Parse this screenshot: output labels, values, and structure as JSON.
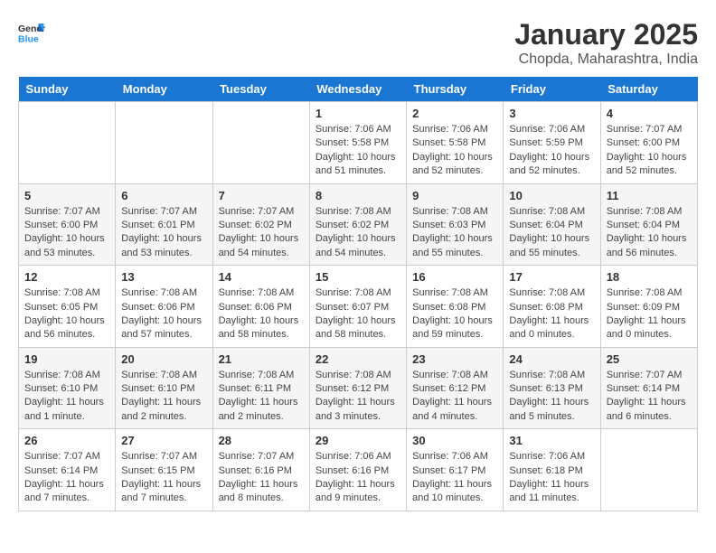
{
  "header": {
    "logo_general": "General",
    "logo_blue": "Blue",
    "month": "January 2025",
    "location": "Chopda, Maharashtra, India"
  },
  "days_of_week": [
    "Sunday",
    "Monday",
    "Tuesday",
    "Wednesday",
    "Thursday",
    "Friday",
    "Saturday"
  ],
  "weeks": [
    [
      {
        "day": "",
        "info": ""
      },
      {
        "day": "",
        "info": ""
      },
      {
        "day": "",
        "info": ""
      },
      {
        "day": "1",
        "info": "Sunrise: 7:06 AM\nSunset: 5:58 PM\nDaylight: 10 hours\nand 51 minutes."
      },
      {
        "day": "2",
        "info": "Sunrise: 7:06 AM\nSunset: 5:58 PM\nDaylight: 10 hours\nand 52 minutes."
      },
      {
        "day": "3",
        "info": "Sunrise: 7:06 AM\nSunset: 5:59 PM\nDaylight: 10 hours\nand 52 minutes."
      },
      {
        "day": "4",
        "info": "Sunrise: 7:07 AM\nSunset: 6:00 PM\nDaylight: 10 hours\nand 52 minutes."
      }
    ],
    [
      {
        "day": "5",
        "info": "Sunrise: 7:07 AM\nSunset: 6:00 PM\nDaylight: 10 hours\nand 53 minutes."
      },
      {
        "day": "6",
        "info": "Sunrise: 7:07 AM\nSunset: 6:01 PM\nDaylight: 10 hours\nand 53 minutes."
      },
      {
        "day": "7",
        "info": "Sunrise: 7:07 AM\nSunset: 6:02 PM\nDaylight: 10 hours\nand 54 minutes."
      },
      {
        "day": "8",
        "info": "Sunrise: 7:08 AM\nSunset: 6:02 PM\nDaylight: 10 hours\nand 54 minutes."
      },
      {
        "day": "9",
        "info": "Sunrise: 7:08 AM\nSunset: 6:03 PM\nDaylight: 10 hours\nand 55 minutes."
      },
      {
        "day": "10",
        "info": "Sunrise: 7:08 AM\nSunset: 6:04 PM\nDaylight: 10 hours\nand 55 minutes."
      },
      {
        "day": "11",
        "info": "Sunrise: 7:08 AM\nSunset: 6:04 PM\nDaylight: 10 hours\nand 56 minutes."
      }
    ],
    [
      {
        "day": "12",
        "info": "Sunrise: 7:08 AM\nSunset: 6:05 PM\nDaylight: 10 hours\nand 56 minutes."
      },
      {
        "day": "13",
        "info": "Sunrise: 7:08 AM\nSunset: 6:06 PM\nDaylight: 10 hours\nand 57 minutes."
      },
      {
        "day": "14",
        "info": "Sunrise: 7:08 AM\nSunset: 6:06 PM\nDaylight: 10 hours\nand 58 minutes."
      },
      {
        "day": "15",
        "info": "Sunrise: 7:08 AM\nSunset: 6:07 PM\nDaylight: 10 hours\nand 58 minutes."
      },
      {
        "day": "16",
        "info": "Sunrise: 7:08 AM\nSunset: 6:08 PM\nDaylight: 10 hours\nand 59 minutes."
      },
      {
        "day": "17",
        "info": "Sunrise: 7:08 AM\nSunset: 6:08 PM\nDaylight: 11 hours\nand 0 minutes."
      },
      {
        "day": "18",
        "info": "Sunrise: 7:08 AM\nSunset: 6:09 PM\nDaylight: 11 hours\nand 0 minutes."
      }
    ],
    [
      {
        "day": "19",
        "info": "Sunrise: 7:08 AM\nSunset: 6:10 PM\nDaylight: 11 hours\nand 1 minute."
      },
      {
        "day": "20",
        "info": "Sunrise: 7:08 AM\nSunset: 6:10 PM\nDaylight: 11 hours\nand 2 minutes."
      },
      {
        "day": "21",
        "info": "Sunrise: 7:08 AM\nSunset: 6:11 PM\nDaylight: 11 hours\nand 2 minutes."
      },
      {
        "day": "22",
        "info": "Sunrise: 7:08 AM\nSunset: 6:12 PM\nDaylight: 11 hours\nand 3 minutes."
      },
      {
        "day": "23",
        "info": "Sunrise: 7:08 AM\nSunset: 6:12 PM\nDaylight: 11 hours\nand 4 minutes."
      },
      {
        "day": "24",
        "info": "Sunrise: 7:08 AM\nSunset: 6:13 PM\nDaylight: 11 hours\nand 5 minutes."
      },
      {
        "day": "25",
        "info": "Sunrise: 7:07 AM\nSunset: 6:14 PM\nDaylight: 11 hours\nand 6 minutes."
      }
    ],
    [
      {
        "day": "26",
        "info": "Sunrise: 7:07 AM\nSunset: 6:14 PM\nDaylight: 11 hours\nand 7 minutes."
      },
      {
        "day": "27",
        "info": "Sunrise: 7:07 AM\nSunset: 6:15 PM\nDaylight: 11 hours\nand 7 minutes."
      },
      {
        "day": "28",
        "info": "Sunrise: 7:07 AM\nSunset: 6:16 PM\nDaylight: 11 hours\nand 8 minutes."
      },
      {
        "day": "29",
        "info": "Sunrise: 7:06 AM\nSunset: 6:16 PM\nDaylight: 11 hours\nand 9 minutes."
      },
      {
        "day": "30",
        "info": "Sunrise: 7:06 AM\nSunset: 6:17 PM\nDaylight: 11 hours\nand 10 minutes."
      },
      {
        "day": "31",
        "info": "Sunrise: 7:06 AM\nSunset: 6:18 PM\nDaylight: 11 hours\nand 11 minutes."
      },
      {
        "day": "",
        "info": ""
      }
    ]
  ]
}
